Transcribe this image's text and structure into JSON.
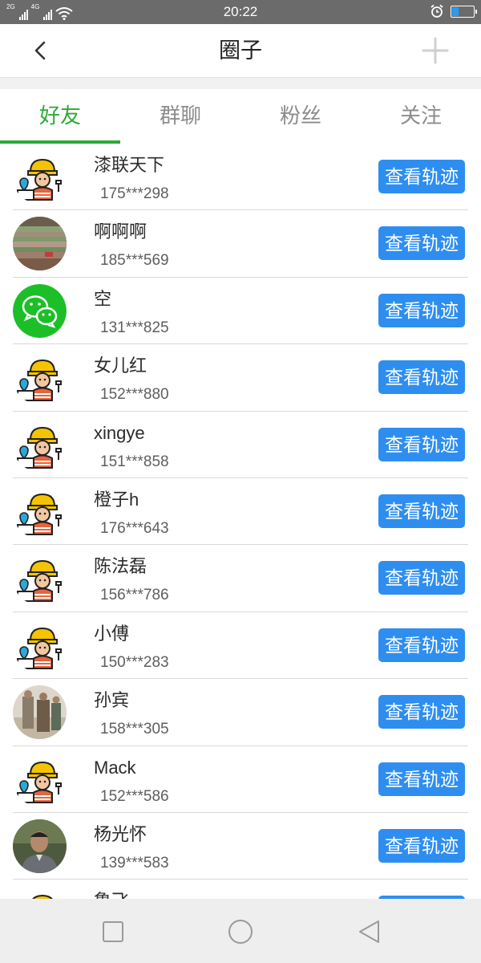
{
  "status_bar": {
    "time": "20:22",
    "network_1": "2G",
    "network_2": "4G",
    "battery_level": 0.3
  },
  "header": {
    "title": "圈子"
  },
  "tabs": [
    {
      "label": "好友",
      "active": true
    },
    {
      "label": "群聊",
      "active": false
    },
    {
      "label": "粉丝",
      "active": false
    },
    {
      "label": "关注",
      "active": false
    }
  ],
  "colors": {
    "accent_green": "#2caa33",
    "button_blue": "#2e8ef0"
  },
  "friends": [
    {
      "name": "漆联天下",
      "phone": "175***298",
      "avatar": "worker-avatar-icon",
      "action": "查看轨迹"
    },
    {
      "name": "啊啊啊",
      "phone": "185***569",
      "avatar": "photo-avatar-field",
      "action": "查看轨迹"
    },
    {
      "name": "空",
      "phone": "131***825",
      "avatar": "wechat-avatar-icon",
      "action": "查看轨迹"
    },
    {
      "name": "女儿红",
      "phone": "152***880",
      "avatar": "worker-avatar-icon",
      "action": "查看轨迹"
    },
    {
      "name": "xingye",
      "phone": "151***858",
      "avatar": "worker-avatar-icon",
      "action": "查看轨迹"
    },
    {
      "name": "橙子h",
      "phone": "176***643",
      "avatar": "worker-avatar-icon",
      "action": "查看轨迹"
    },
    {
      "name": "陈法磊",
      "phone": "156***786",
      "avatar": "worker-avatar-icon",
      "action": "查看轨迹"
    },
    {
      "name": "小傅",
      "phone": "150***283",
      "avatar": "worker-avatar-icon",
      "action": "查看轨迹"
    },
    {
      "name": "孙宾",
      "phone": "158***305",
      "avatar": "photo-avatar-people",
      "action": "查看轨迹"
    },
    {
      "name": "Mack",
      "phone": "152***586",
      "avatar": "worker-avatar-icon",
      "action": "查看轨迹"
    },
    {
      "name": "杨光怀",
      "phone": "139***583",
      "avatar": "photo-avatar-man",
      "action": "查看轨迹"
    },
    {
      "name": "鲁飞",
      "phone": "",
      "avatar": "worker-avatar-icon",
      "action": "查看轨迹"
    }
  ],
  "nav_bar": {
    "buttons": [
      "recents-icon",
      "home-icon",
      "back-triangle-icon"
    ]
  }
}
